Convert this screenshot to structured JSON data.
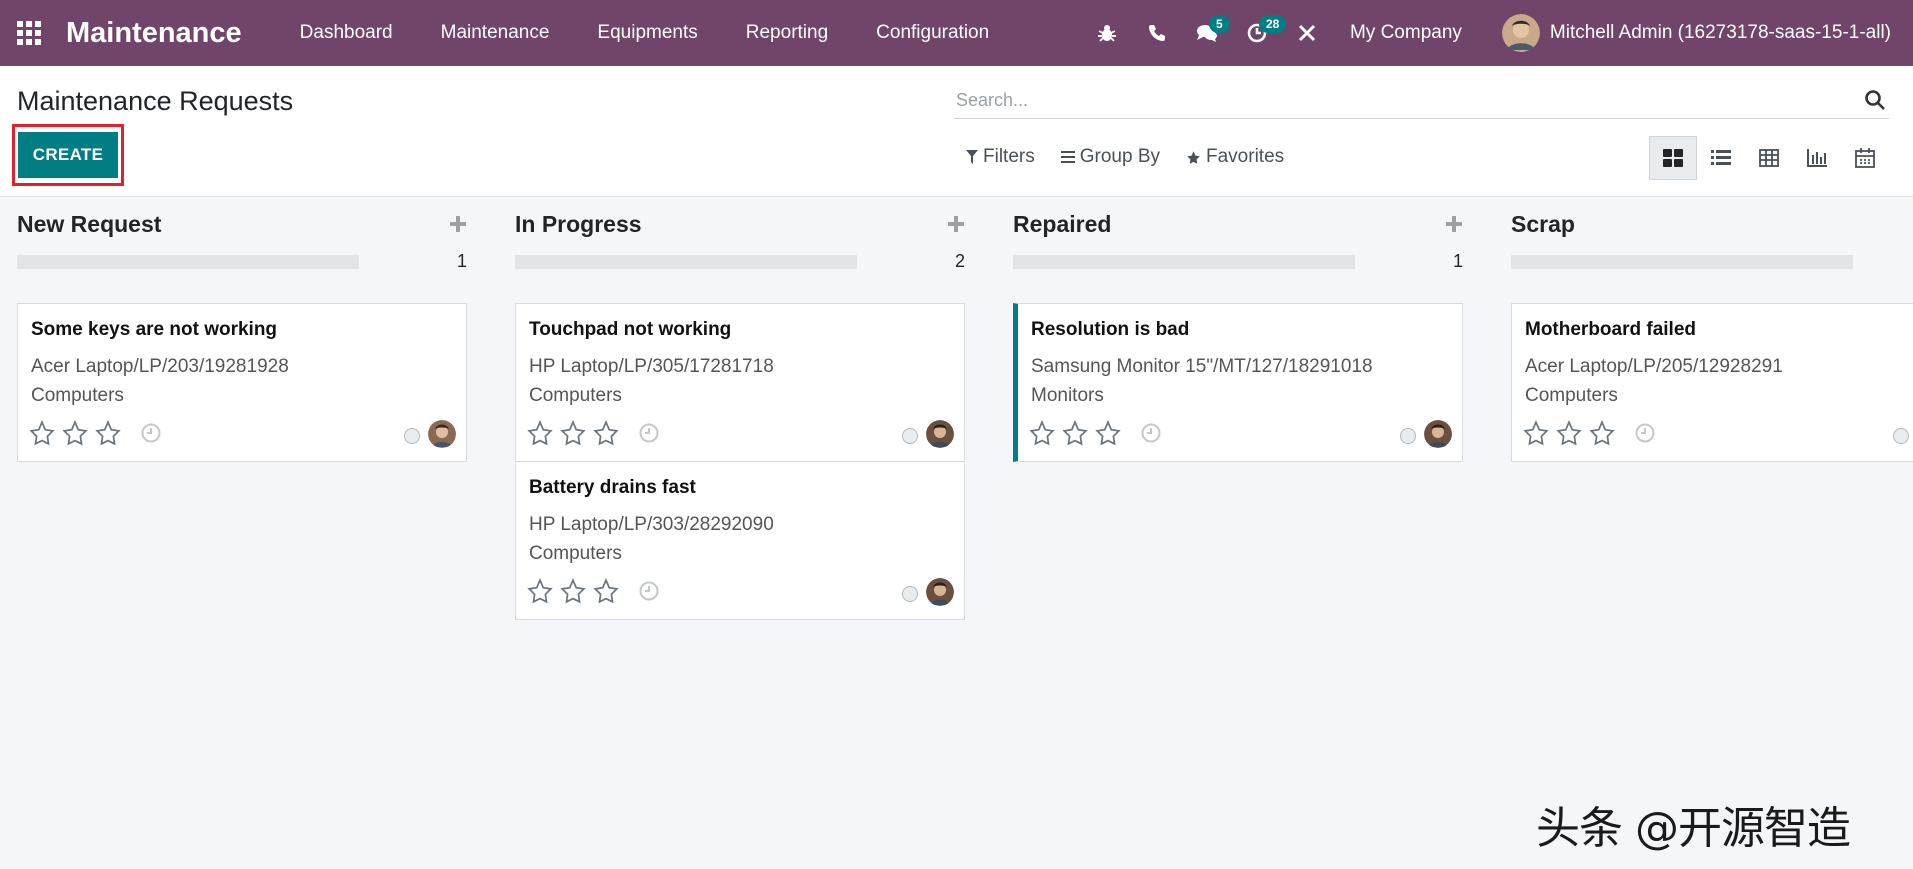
{
  "navbar": {
    "app_name": "Maintenance",
    "menu": [
      "Dashboard",
      "Maintenance",
      "Equipments",
      "Reporting",
      "Configuration"
    ],
    "systray": {
      "icons": [
        "bug-icon",
        "phone-icon",
        "chat-icon",
        "activity-clock-icon",
        "tools-icon"
      ],
      "messages_count": "5",
      "activities_count": "28"
    },
    "company": "My Company",
    "user": "Mitchell Admin (16273178-saas-15-1-all)",
    "colors": {
      "bar": "#71446a",
      "badge": "#017e84"
    }
  },
  "control_panel": {
    "title": "Maintenance Requests",
    "create_label": "CREATE",
    "search_placeholder": "Search...",
    "filters_label": "Filters",
    "group_by_label": "Group By",
    "favorites_label": "Favorites",
    "views": [
      "kanban-icon",
      "list-icon",
      "pivot-icon",
      "graph-icon",
      "calendar-icon"
    ],
    "active_view": "kanban",
    "accent_color": "#017e84",
    "highlight_color": "#e0202c"
  },
  "kanban": {
    "columns": [
      {
        "title": "New Request",
        "count": "1",
        "cards": [
          {
            "title": "Some keys are not working",
            "equipment": "Acer Laptop/LP/203/19281928",
            "category": "Computers"
          }
        ]
      },
      {
        "title": "In Progress",
        "count": "2",
        "cards": [
          {
            "title": "Touchpad not working",
            "equipment": "HP Laptop/LP/305/17281718",
            "category": "Computers"
          },
          {
            "title": "Battery drains fast",
            "equipment": "HP Laptop/LP/303/28292090",
            "category": "Computers"
          }
        ]
      },
      {
        "title": "Repaired",
        "count": "1",
        "cards": [
          {
            "title": "Resolution is bad",
            "equipment": "Samsung Monitor 15\"/MT/127/18291018",
            "category": "Monitors"
          }
        ]
      },
      {
        "title": "Scrap",
        "count": "",
        "cards": [
          {
            "title": "Motherboard failed",
            "equipment": "Acer Laptop/LP/205/12928291",
            "category": "Computers"
          }
        ]
      }
    ]
  },
  "watermark": "头条 @开源智造"
}
